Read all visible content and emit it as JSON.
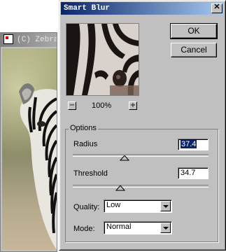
{
  "background_window": {
    "title": "(C) Zebra"
  },
  "dialog": {
    "title": "Smart Blur",
    "close_glyph": "✕",
    "ok_label": "OK",
    "cancel_label": "Cancel",
    "zoom_out_glyph": "−",
    "zoom_in_glyph": "+",
    "zoom_level": "100%",
    "options": {
      "group_label": "Options",
      "radius_label": "Radius",
      "radius_value": "37.4",
      "threshold_label": "Threshold",
      "threshold_value": "34.7",
      "quality_label": "Quality:",
      "quality_selected": "Low",
      "mode_label": "Mode:",
      "mode_selected": "Normal"
    }
  },
  "colors": {
    "titlebar_start": "#0a246a",
    "titlebar_end": "#a6caf0",
    "dialog_face": "#c0c0c0",
    "selection": "#0a246a"
  }
}
